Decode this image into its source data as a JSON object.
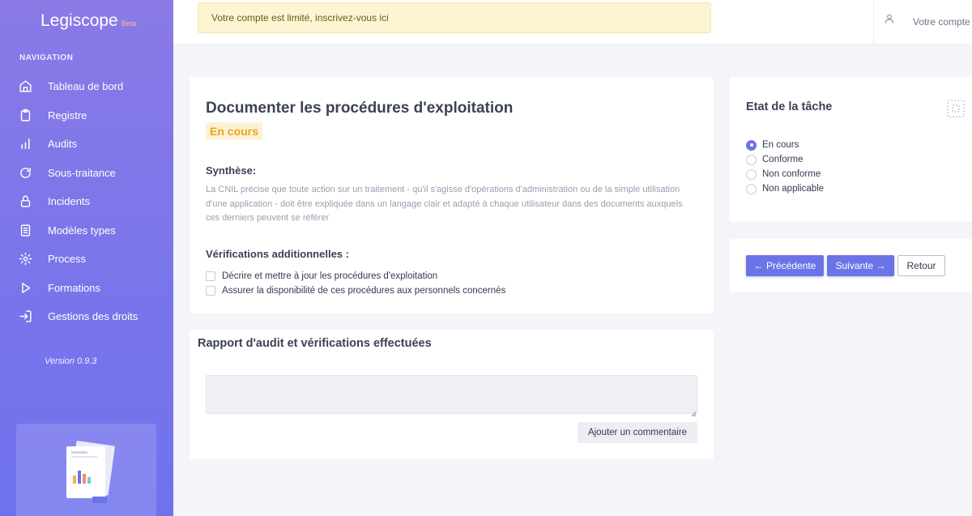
{
  "sidebar": {
    "brand": "Legiscope",
    "beta": "Beta",
    "nav_heading": "NAVIGATION",
    "items": [
      {
        "label": "Tableau de bord",
        "icon": "home-icon"
      },
      {
        "label": "Registre",
        "icon": "clipboard-icon"
      },
      {
        "label": "Audits",
        "icon": "bar-chart-icon"
      },
      {
        "label": "Sous-traitance",
        "icon": "refresh-icon"
      },
      {
        "label": "Incidents",
        "icon": "lock-icon"
      },
      {
        "label": "Modèles types",
        "icon": "document-icon"
      },
      {
        "label": "Process",
        "icon": "gear-icon"
      },
      {
        "label": "Formations",
        "icon": "play-icon"
      },
      {
        "label": "Gestions des droits",
        "icon": "login-icon"
      }
    ],
    "version": "Version 0.9.3"
  },
  "topbar": {
    "alert": "Votre compte est limité, inscrivez-vous ici",
    "account_label": "Votre compte"
  },
  "task": {
    "title": "Documenter les procédures d'exploitation",
    "status": "En cours",
    "synthesis_heading": "Synthèse:",
    "synthesis_text": "La CNIL précise que toute action sur un traitement - qu'il s'agisse d'opérations d'administration ou de la simple utilisation d'une application - doit être expliquée dans un langage clair et adapté à chaque utilisateur dans des documents auxquels ces derniers peuvent se référer",
    "verifications_heading": "Vérifications additionnelles :",
    "verifications": [
      "Décrire et mettre à jour les procédures d'exploitation",
      "Assurer la disponibilité de ces procédures aux personnels concernés"
    ]
  },
  "report": {
    "heading": "Rapport d'audit et vérifications effectuées",
    "input_value": "",
    "comment_button": "Ajouter un commentaire"
  },
  "state": {
    "heading": "Etat de la tâche",
    "options": [
      "En cours",
      "Conforme",
      "Non conforme",
      "Non applicable"
    ],
    "selected": "En cours"
  },
  "navigation_buttons": {
    "prev": "← Précédente",
    "next": "Suivante →",
    "back": "Retour"
  },
  "colors": {
    "accent": "#6b74e6",
    "status_badge_bg": "#fdf1d6",
    "status_badge_text": "#e9a713",
    "alert_bg": "#fdf4d2"
  }
}
